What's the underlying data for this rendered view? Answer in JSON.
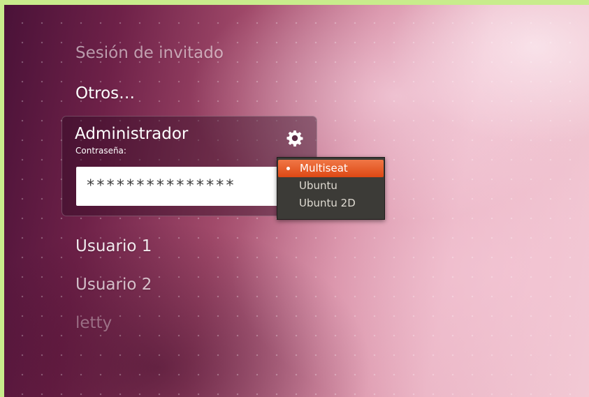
{
  "users": {
    "guest": "Sesión de invitado",
    "others": "Otros…",
    "user1": "Usuario 1",
    "user2": "Usuario 2",
    "letty": "letty"
  },
  "login": {
    "username": "Administrador",
    "password_label": "Contraseña:",
    "password_value": "***************",
    "settings_icon": "gear-icon"
  },
  "session_menu": {
    "items": [
      {
        "label": "Multiseat",
        "selected": true
      },
      {
        "label": "Ubuntu",
        "selected": false
      },
      {
        "label": "Ubuntu 2D",
        "selected": false
      }
    ],
    "highlight_color": "#dd4814",
    "background_color": "#3c3b37"
  },
  "colors": {
    "frame_border": "#c8ec8c",
    "accent": "#dd4814"
  }
}
